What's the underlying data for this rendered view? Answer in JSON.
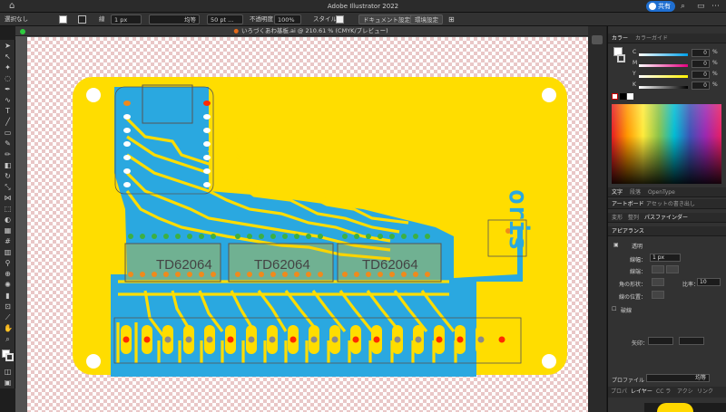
{
  "app": {
    "title": "Adobe Illustrator 2022",
    "share_label": "共有"
  },
  "controlbar": {
    "selection": "選択なし",
    "stroke_label": "線",
    "stroke_weight": "1 px",
    "profile": "均等",
    "brush": "50 pt ...",
    "opacity_label": "不透明度",
    "opacity_value": "100%",
    "style_label": "スタイル",
    "doc_settings": "ドキュメント設定",
    "env_settings": "環境設定"
  },
  "document": {
    "tab_title": "いろづくあわ基板.ai @ 210.61 % (CMYK/プレビュー)"
  },
  "artwork": {
    "chip_label": "TD62064",
    "mirror_text": "oris",
    "colors": {
      "board": "#ffdd00",
      "copper": "#2aa8e0",
      "outline": "#555555",
      "pad_red": "#ff2a00",
      "pad_green": "#3cb043",
      "pad_orange": "#f08a1c",
      "pad_gray": "#8a8a8a"
    }
  },
  "color_panel": {
    "tab_color": "カラー",
    "tab_guide": "カラーガイド",
    "channels": [
      {
        "name": "C",
        "value": "0"
      },
      {
        "name": "M",
        "value": "0"
      },
      {
        "name": "Y",
        "value": "0"
      },
      {
        "name": "K",
        "value": "0"
      }
    ],
    "pct": "%"
  },
  "char_tabs": [
    "文字",
    "段落",
    "OpenType"
  ],
  "artboard_tabs": [
    "アートボード",
    "アセットの書き出し"
  ],
  "transform_tabs": [
    "変形",
    "整列",
    "パスファインダー"
  ],
  "appearance": {
    "title": "アピアランス",
    "transparency": "透明",
    "stroke_label": "線幅：",
    "stroke_value": "1 px",
    "corner_label": "線端：",
    "join_label": "角の形状：",
    "limit_label": "比率：",
    "limit_value": "10",
    "align_label": "線の位置：",
    "dashed_label": "破線",
    "arrow_label": "矢印：",
    "profile_label": "プロファイル",
    "profile_value": "均等"
  },
  "bottom_tabs": [
    "プロパ",
    "レイヤー",
    "CC ラ",
    "アクシ",
    "リンク"
  ]
}
